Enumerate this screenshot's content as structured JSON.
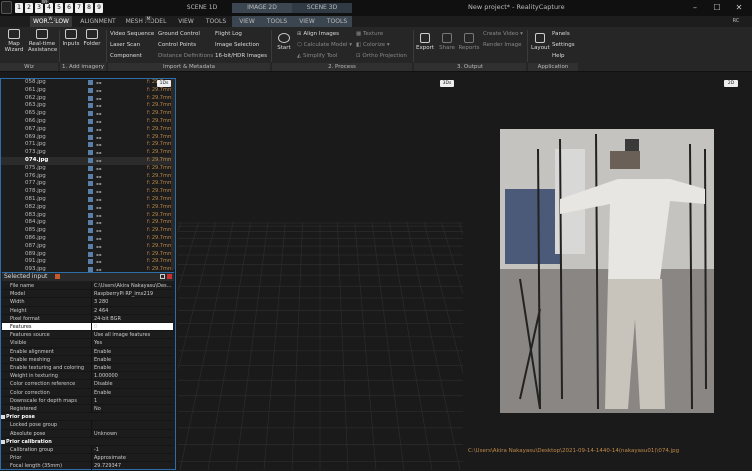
{
  "window": {
    "title": "New project* - RealityCapture",
    "min": "–",
    "max": "☐",
    "close": "✕"
  },
  "quick_access": [
    "1",
    "2",
    "3",
    "4",
    "5",
    "6",
    "7",
    "8",
    "9"
  ],
  "quick_hints": {
    "top": "WF",
    "tab_wf": "W",
    "tab_mesh": "M"
  },
  "tabs": {
    "workflow": "WORKFLOW",
    "alignment": "ALIGNMENT",
    "mesh_model": "MESH MODEL",
    "view": "VIEW",
    "tools": "TOOLS",
    "scene1d": "SCENE 1D",
    "image2d": "IMAGE 2D",
    "scene3d": "SCENE 3D",
    "view2": "VIEW",
    "tools2": "TOOLS",
    "view3": "VIEW",
    "tools3": "TOOLS",
    "rc": "RC"
  },
  "ribbon": {
    "wiz": {
      "map_wizard": "Map Wizard",
      "realtime": "Real-time Assistance",
      "title": "Wiz"
    },
    "add": {
      "inputs": "Inputs",
      "folder": "Folder",
      "title": "1. Add imagery"
    },
    "import": {
      "video_sequence": "Video Sequence",
      "laser_scan": "Laser Scan",
      "component": "Component",
      "ground_control": "Ground Control",
      "control_points": "Control Points",
      "distance_definitions": "Distance Definitions",
      "flight_log": "Flight Log",
      "image_selection": "Image Selection",
      "hdr_images": "16-bit/HDR Images",
      "title": "Import & Metadata"
    },
    "process": {
      "start": "Start",
      "align_images": "Align Images",
      "calculate_model": "Calculate Model",
      "simplify_tool": "Simplify Tool",
      "texture": "Texture",
      "colorize": "Colorize",
      "ortho_projection": "Ortho Projection",
      "title": "2. Process"
    },
    "output": {
      "export": "Export",
      "share": "Share",
      "reports": "Reports",
      "create_video": "Create Video",
      "render_image": "Render Image",
      "title": "3. Output"
    },
    "application": {
      "layout": "Layout",
      "panels": "Panels",
      "settings": "Settings",
      "help": "Help",
      "title": "Application"
    }
  },
  "list_badge": "1Ds",
  "file_list": [
    {
      "name": "058.jpg",
      "val": "f: 29.7mm"
    },
    {
      "name": "061.jpg",
      "val": "f: 29.7mm"
    },
    {
      "name": "062.jpg",
      "val": "f: 29.7mm"
    },
    {
      "name": "063.jpg",
      "val": "f: 29.7mm"
    },
    {
      "name": "065.jpg",
      "val": "f: 29.7mm"
    },
    {
      "name": "066.jpg",
      "val": "f: 29.7mm"
    },
    {
      "name": "067.jpg",
      "val": "f: 29.7mm"
    },
    {
      "name": "069.jpg",
      "val": "f: 29.7mm"
    },
    {
      "name": "071.jpg",
      "val": "f: 29.7mm"
    },
    {
      "name": "073.jpg",
      "val": "f: 29.7mm"
    },
    {
      "name": "074.jpg",
      "val": "f: 29.7mm"
    },
    {
      "name": "075.jpg",
      "val": "f: 29.7mm"
    },
    {
      "name": "076.jpg",
      "val": "f: 29.7mm"
    },
    {
      "name": "077.jpg",
      "val": "f: 29.7mm"
    },
    {
      "name": "078.jpg",
      "val": "f: 29.7mm"
    },
    {
      "name": "081.jpg",
      "val": "f: 29.7mm"
    },
    {
      "name": "082.jpg",
      "val": "f: 29.7mm"
    },
    {
      "name": "083.jpg",
      "val": "f: 29.7mm"
    },
    {
      "name": "084.jpg",
      "val": "f: 29.7mm"
    },
    {
      "name": "085.jpg",
      "val": "f: 29.7mm"
    },
    {
      "name": "086.jpg",
      "val": "f: 29.7mm"
    },
    {
      "name": "087.jpg",
      "val": "f: 29.7mm"
    },
    {
      "name": "089.jpg",
      "val": "f: 29.7mm"
    },
    {
      "name": "091.jpg",
      "val": "f: 29.7mm"
    },
    {
      "name": "093.jpg",
      "val": "f: 29.7mm"
    }
  ],
  "selected_file": "074.jpg",
  "selected_input": {
    "title": "Selected input",
    "rows": [
      {
        "k": "File name",
        "v": "C:\\Users\\Akira Nakayasu\\Des..."
      },
      {
        "k": "Model",
        "v": "RaspberryPi RP_imx219"
      },
      {
        "k": "Width",
        "v": "3 280"
      },
      {
        "k": "Height",
        "v": "2 464"
      },
      {
        "k": "Pixel format",
        "v": "24-bit BGR"
      },
      {
        "k": "Features",
        "v": "0"
      },
      {
        "k": "Features source",
        "v": "Use all image features"
      },
      {
        "k": "Visible",
        "v": "Yes"
      },
      {
        "k": "Enable alignment",
        "v": "Enable"
      },
      {
        "k": "Enable meshing",
        "v": "Enable"
      },
      {
        "k": "Enable texturing and coloring",
        "v": "Enable"
      },
      {
        "k": "Weight in texturing",
        "v": "1.000000"
      },
      {
        "k": "Color correction reference",
        "v": "Disable"
      },
      {
        "k": "Color correction",
        "v": "Enable"
      },
      {
        "k": "Downscale for depth maps",
        "v": "1"
      },
      {
        "k": "Registered",
        "v": "No"
      },
      {
        "k": "Prior pose",
        "v": "",
        "section": true
      },
      {
        "k": "Locked pose group",
        "v": ""
      },
      {
        "k": "Absolute pose",
        "v": "Unknown"
      },
      {
        "k": "Prior calibration",
        "v": "",
        "section": true
      },
      {
        "k": "Calibration group",
        "v": "-1"
      },
      {
        "k": "Prior",
        "v": "Approximate"
      },
      {
        "k": "Focal length (35mm)",
        "v": "29.729347"
      }
    ]
  },
  "viewports": {
    "scene3d_badge": "3Ds",
    "image2d_badge": "2D",
    "image_path": "C:\\Users\\Akira Nakayasu\\Desktop\\2021-09-14-1440-14(nakayasu01)\\074.jpg"
  },
  "colors": {
    "accent": "#2e6ea8",
    "focal_orange": "#c08a4a",
    "active_tab": "#3a3a3a",
    "scene_tab": "#3b4650"
  }
}
